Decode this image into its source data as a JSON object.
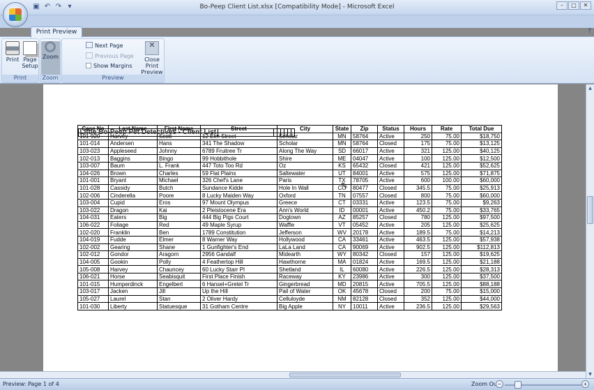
{
  "window": {
    "title": "Bo-Peep Client List.xlsx  [Compatibility Mode]  -  Microsoft Excel",
    "quick_access": [
      "save",
      "undo",
      "redo",
      "customize"
    ]
  },
  "ribbon": {
    "active_tab": "Print Preview",
    "groups": [
      {
        "label": "Print",
        "buttons": [
          {
            "label": "Print"
          },
          {
            "label": "Page Setup"
          }
        ]
      },
      {
        "label": "Zoom",
        "buttons": [
          {
            "label": "Zoom"
          }
        ]
      },
      {
        "label": "Preview",
        "next_page": "Next Page",
        "previous_page": "Previous Page",
        "show_margins": "Show Margins",
        "close": "Close Print Preview"
      }
    ]
  },
  "status": {
    "text": "Preview: Page 1 of 4",
    "zoom_label": "Zoom Out"
  },
  "sheet": {
    "title": "Little Bo-Peep Pet Detectives - Client List",
    "columns": [
      "Case No",
      "Last Name",
      "First Name",
      "Street",
      "City",
      "State",
      "Zip",
      "Status",
      "Hours",
      "Rate",
      "Total Due"
    ],
    "rows": [
      [
        "101-920",
        "Harvey",
        "Scott",
        "12 Elm Street",
        "Scholar",
        "MN",
        "58764",
        "Active",
        "250",
        "75.00",
        "$18,750"
      ],
      [
        "101-014",
        "Andersen",
        "Hans",
        "341 The Shadow",
        "Scholar",
        "MN",
        "58764",
        "Closed",
        "175",
        "75.00",
        "$13,125"
      ],
      [
        "103-023",
        "Appleseed",
        "Johnny",
        "6789 Fruitree Tr",
        "Along The Way",
        "SD",
        "66017",
        "Active",
        "321",
        "125.00",
        "$40,125"
      ],
      [
        "102-013",
        "Baggins",
        "Bingo",
        "99 Hobbithole",
        "Shire",
        "ME",
        "04047",
        "Active",
        "100",
        "125.00",
        "$12,500"
      ],
      [
        "103-007",
        "Baum",
        "L. Frank",
        "447 Toto Too Rd",
        "Oz",
        "KS",
        "65432",
        "Closed",
        "421",
        "125.00",
        "$52,625"
      ],
      [
        "104-026",
        "Brown",
        "Charles",
        "59 Flat Plains",
        "Saltewater",
        "UT",
        "84001",
        "Active",
        "575",
        "125.00",
        "$71,875"
      ],
      [
        "101-001",
        "Bryant",
        "Michael",
        "326 Chef's Lane",
        "Paris",
        "TX",
        "78705",
        "Active",
        "600",
        "100.00",
        "$60,000"
      ],
      [
        "101-028",
        "Cassidy",
        "Butch",
        "Sundance Kidde",
        "Hole In Wall",
        "CO",
        "80477",
        "Closed",
        "345.5",
        "75.00",
        "$25,913"
      ],
      [
        "102-006",
        "Cinderella",
        "Poore",
        "8 Lucky Maiden Way",
        "Oxford",
        "TN",
        "07557",
        "Closed",
        "800",
        "75.00",
        "$60,000"
      ],
      [
        "103-004",
        "Cupid",
        "Eros",
        "97 Mount Olympus",
        "Greece",
        "CT",
        "03331",
        "Active",
        "123.5",
        "75.00",
        "$9,263"
      ],
      [
        "103-022",
        "Dragon",
        "Kai",
        "2 Pleistocene Era",
        "Ann's World",
        "ID",
        "00001",
        "Active",
        "450.2",
        "75.00",
        "$33,765"
      ],
      [
        "104-031",
        "Eaters",
        "Big",
        "444 Big Pigs Court",
        "Dogtown",
        "AZ",
        "85257",
        "Closed",
        "780",
        "125.00",
        "$97,500"
      ],
      [
        "106-022",
        "Foliage",
        "Red",
        "49 Maple Syrup",
        "Waffle",
        "VT",
        "05452",
        "Active",
        "205",
        "125.00",
        "$25,625"
      ],
      [
        "102-020",
        "Franklin",
        "Ben",
        "1789 Constitution",
        "Jefferson",
        "WV",
        "20178",
        "Active",
        "189.5",
        "75.00",
        "$14,213"
      ],
      [
        "104-019",
        "Fudde",
        "Elmer",
        "8 Warner Way",
        "Hollywood",
        "CA",
        "33461",
        "Active",
        "463.5",
        "125.00",
        "$57,938"
      ],
      [
        "102-002",
        "Gearing",
        "Shane",
        "1 Gunfighter's End",
        "LaLa Land",
        "CA",
        "90069",
        "Active",
        "902.5",
        "125.00",
        "$112,813"
      ],
      [
        "102-012",
        "Gondor",
        "Aragorn",
        "2956 Gandalf",
        "Midearth",
        "WY",
        "80342",
        "Closed",
        "157",
        "125.00",
        "$19,625"
      ],
      [
        "104-005",
        "Gookin",
        "Polly",
        "4 Feathertop Hill",
        "Hawthorne",
        "MA",
        "01824",
        "Active",
        "169.5",
        "125.00",
        "$21,188"
      ],
      [
        "105-008",
        "Harvey",
        "Chauncey",
        "60 Lucky Starr Pl",
        "Shetland",
        "IL",
        "60080",
        "Active",
        "226.5",
        "125.00",
        "$28,313"
      ],
      [
        "106-021",
        "Horse",
        "Seabisquit",
        "First Place Finish",
        "Raceway",
        "KY",
        "23986",
        "Active",
        "300",
        "125.00",
        "$37,500"
      ],
      [
        "101-015",
        "Humperdinck",
        "Engelbert",
        "6 Hansel+Gretel Tr",
        "Gingerbread",
        "MD",
        "20815",
        "Active",
        "705.5",
        "125.00",
        "$88,188"
      ],
      [
        "103-017",
        "Jacken",
        "Jill",
        "Up the Hill",
        "Pail of Water",
        "OK",
        "45678",
        "Closed",
        "200",
        "75.00",
        "$15,000"
      ],
      [
        "105-027",
        "Laurel",
        "Stan",
        "2 Oliver Hardy",
        "Celluloyde",
        "NM",
        "82128",
        "Closed",
        "352",
        "125.00",
        "$44,000"
      ],
      [
        "101-030",
        "Liberty",
        "Statuesque",
        "31 Gotham Centre",
        "Big Apple",
        "NY",
        "10011",
        "Active",
        "236.5",
        "125.00",
        "$29,563"
      ]
    ]
  }
}
